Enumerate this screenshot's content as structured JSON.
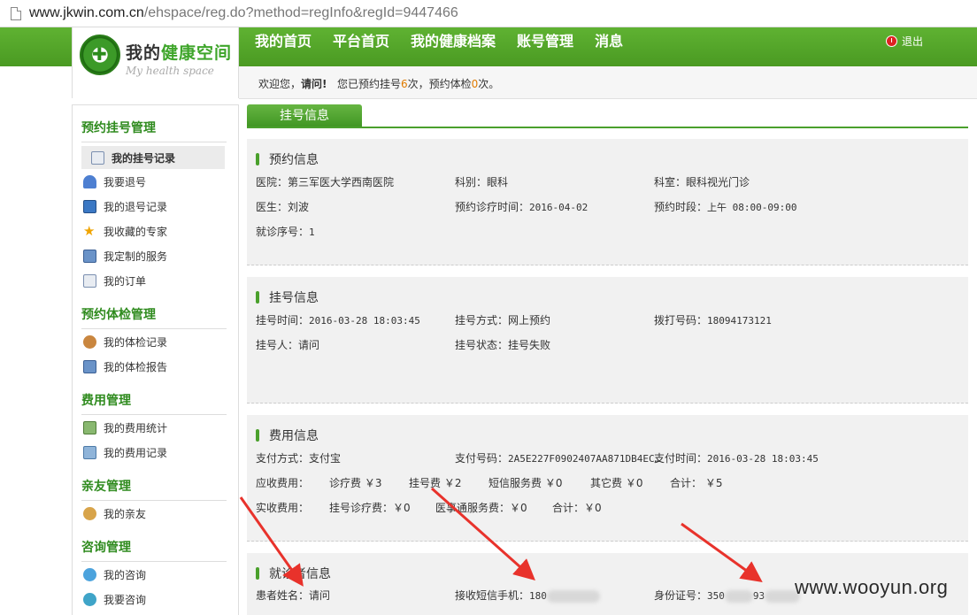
{
  "browser": {
    "url_host": "www.jkwin.com.cn",
    "url_path": "/ehspace/reg.do?method=regInfo&regId=9447466"
  },
  "logo": {
    "title_prefix": "我的",
    "title_accent": "健康空间",
    "subtitle": "My health space"
  },
  "nav": {
    "items": [
      "我的首页",
      "平台首页",
      "我的健康档案",
      "账号管理",
      "消息"
    ],
    "logout": "退出"
  },
  "welcome": {
    "prefix": "欢迎您，",
    "name": "请问!",
    "text1": "您已预约挂号",
    "reg_count": "6",
    "text2": "次，预约体检",
    "exam_count": "0",
    "text3": "次。"
  },
  "sidebar": {
    "groups": [
      {
        "title": "预约挂号管理",
        "items": [
          "我的挂号记录",
          "我要退号",
          "我的退号记录",
          "我收藏的专家",
          "我定制的服务",
          "我的订单"
        ]
      },
      {
        "title": "预约体检管理",
        "items": [
          "我的体检记录",
          "我的体检报告"
        ]
      },
      {
        "title": "费用管理",
        "items": [
          "我的费用统计",
          "我的费用记录"
        ]
      },
      {
        "title": "亲友管理",
        "items": [
          "我的亲友"
        ]
      },
      {
        "title": "咨询管理",
        "items": [
          "我的咨询",
          "我要咨询"
        ]
      }
    ]
  },
  "tab": {
    "label": "挂号信息"
  },
  "appointment": {
    "title": "预约信息",
    "hospital": "医院：第三军医大学西南医院",
    "dept": "科别：眼科",
    "room": "科室：眼科视光门诊",
    "doctor": "医生：刘波",
    "date_label": "预约诊疗时间：",
    "date": "2016-04-02",
    "slot_label": "预约时段：",
    "slot": "上午 08:00-09:00",
    "seq_label": "就诊序号：",
    "seq": "1"
  },
  "registration": {
    "title": "挂号信息",
    "time_label": "挂号时间：",
    "time": "2016-03-28 18:03:45",
    "method": "挂号方式：网上预约",
    "phone_label": "拨打号码：",
    "phone": "18094173121",
    "person": "挂号人：请问",
    "status": "挂号状态：挂号失败"
  },
  "fees": {
    "title": "费用信息",
    "pay_method": "支付方式：支付宝",
    "pay_no_label": "支付号码：",
    "pay_no": "2A5E227F0902407AA871DB4EC…",
    "pay_time_label": "支付时间：",
    "pay_time": "2016-03-28 18:03:45",
    "due_label": "应收费用：",
    "due_items": [
      "诊疗费 ￥3",
      "挂号费 ￥2",
      "短信服务费 ￥0",
      "其它费 ￥0",
      "合计： ￥5"
    ],
    "paid_label": "实收费用：",
    "paid_items": [
      "挂号诊疗费：￥0",
      "医事通服务费：￥0",
      "合计：￥0"
    ]
  },
  "patient": {
    "title": "就诊者信息",
    "name": "患者姓名：请问",
    "sms_label": "接收短信手机：",
    "sms_prefix": "180",
    "id_label": "身份证号：",
    "id_prefix": "350",
    "id_suffix": "93"
  },
  "watermark": "www.wooyun.org",
  "colors": {
    "brand_green": "#4aa02c",
    "accent_orange": "#e07b00",
    "arrow_red": "#e8322b"
  }
}
